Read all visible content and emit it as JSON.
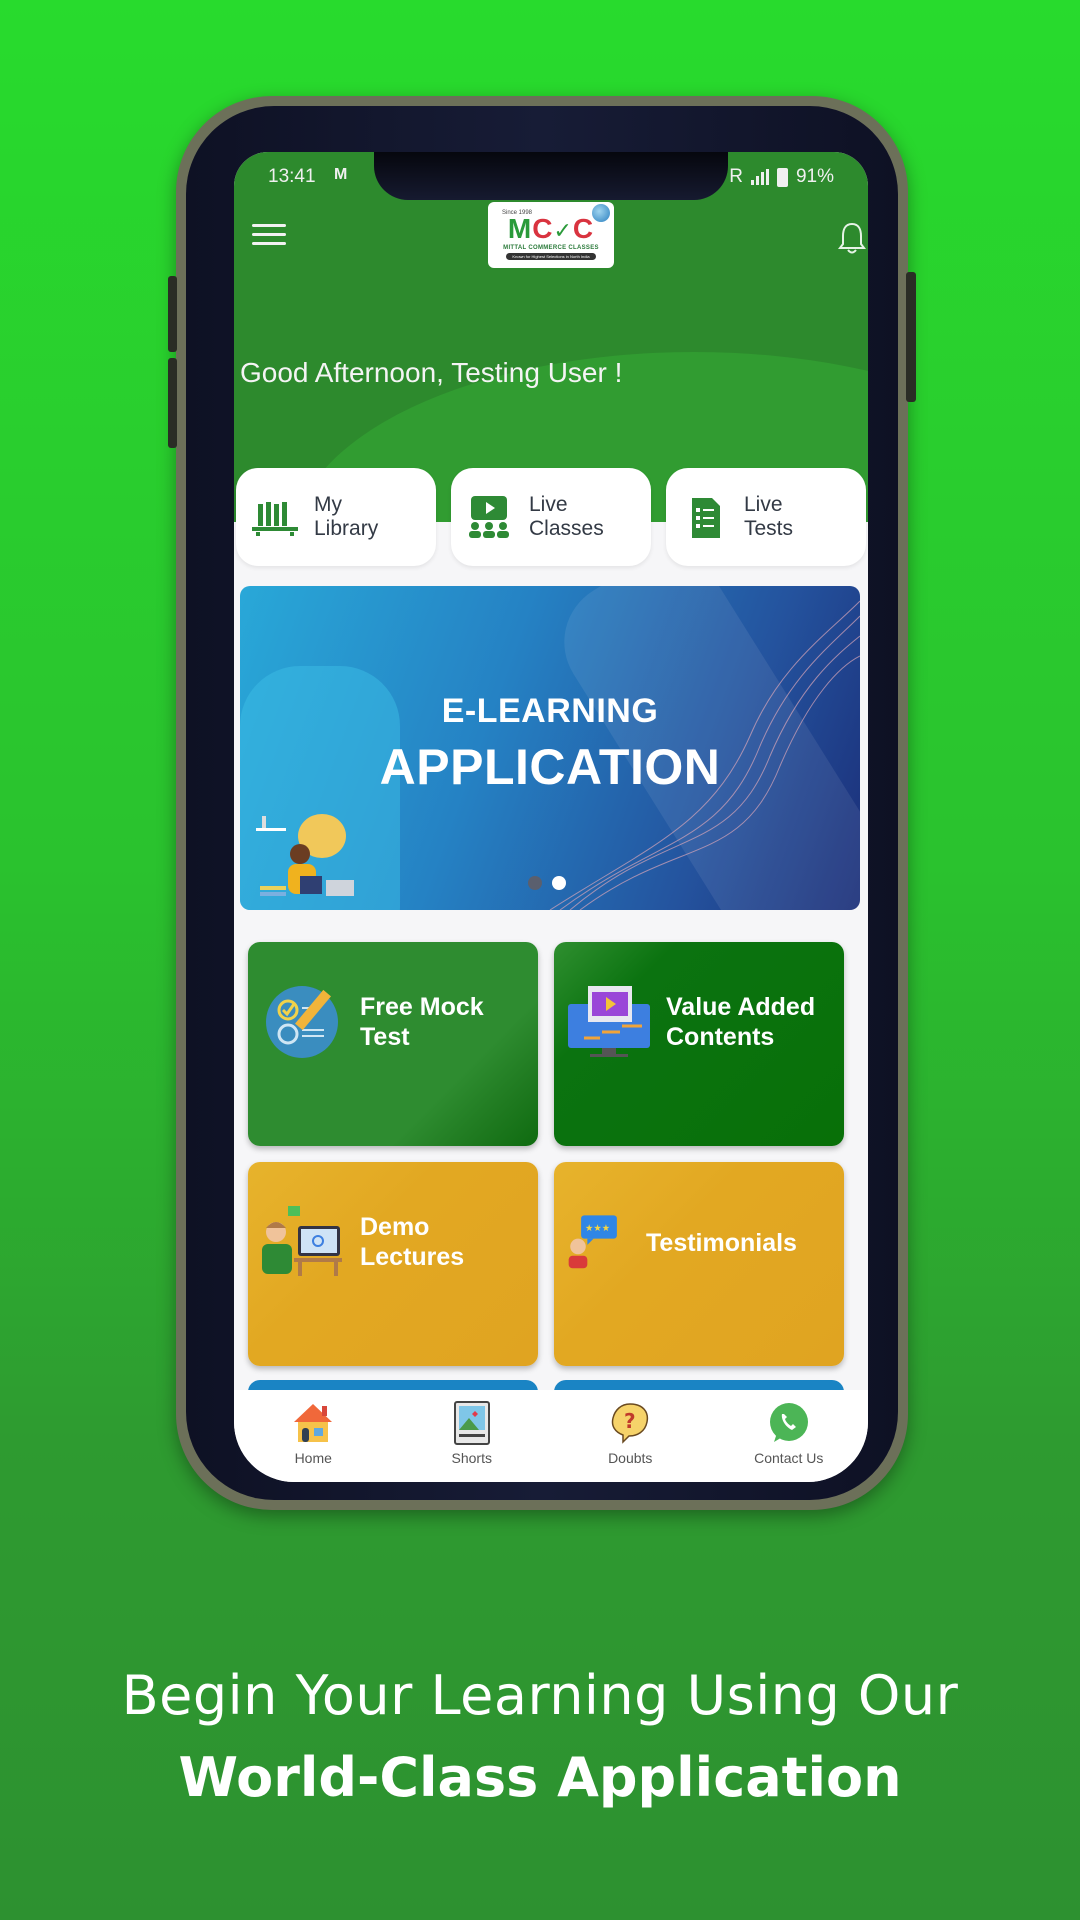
{
  "status_bar": {
    "time": "13:41",
    "mail_icon": "gmail-icon",
    "network": "R",
    "battery": "91%"
  },
  "header": {
    "menu_icon": "hamburger-menu-icon",
    "notification_icon": "bell-icon",
    "logo": {
      "since": "Since 1998",
      "mark": "MCC",
      "name": "MITTAL COMMERCE CLASSES",
      "tagline": "Known for Highest Selections in North India"
    },
    "greeting": "Good Afternoon, Testing User !"
  },
  "quick_actions": [
    {
      "label": "My\nLibrary",
      "icon": "library-books-icon"
    },
    {
      "label": "Live\nClasses",
      "icon": "live-class-video-icon"
    },
    {
      "label": "Live\nTests",
      "icon": "test-document-icon"
    }
  ],
  "banner": {
    "line1": "E-LEARNING",
    "line2": "APPLICATION",
    "slides": 2,
    "active_slide": 2
  },
  "tiles": [
    {
      "label": "Free Mock\nTest",
      "icon": "mock-test-checklist-icon",
      "color": "#2e8c30"
    },
    {
      "label": "Value Added\nContents",
      "icon": "video-monitor-icon",
      "color": "#087008"
    },
    {
      "label": "Demo\nLectures",
      "icon": "teacher-lecture-icon",
      "color": "#e2a822"
    },
    {
      "label": "Testimonials",
      "icon": "testimonial-rating-icon",
      "color": "#e2a822"
    }
  ],
  "bottom_nav": [
    {
      "label": "Home",
      "icon": "home-icon"
    },
    {
      "label": "Shorts",
      "icon": "shorts-photo-icon"
    },
    {
      "label": "Doubts",
      "icon": "question-bubble-icon"
    },
    {
      "label": "Contact Us",
      "icon": "whatsapp-icon"
    }
  ],
  "caption": {
    "line1": "Begin Your Learning Using Our",
    "line2": "World-Class Application"
  },
  "colors": {
    "brand_green": "#2d8a2d",
    "background_top": "#28db2d",
    "background_bottom": "#2d9130",
    "gold": "#e2a822",
    "blue": "#1a84c4"
  }
}
